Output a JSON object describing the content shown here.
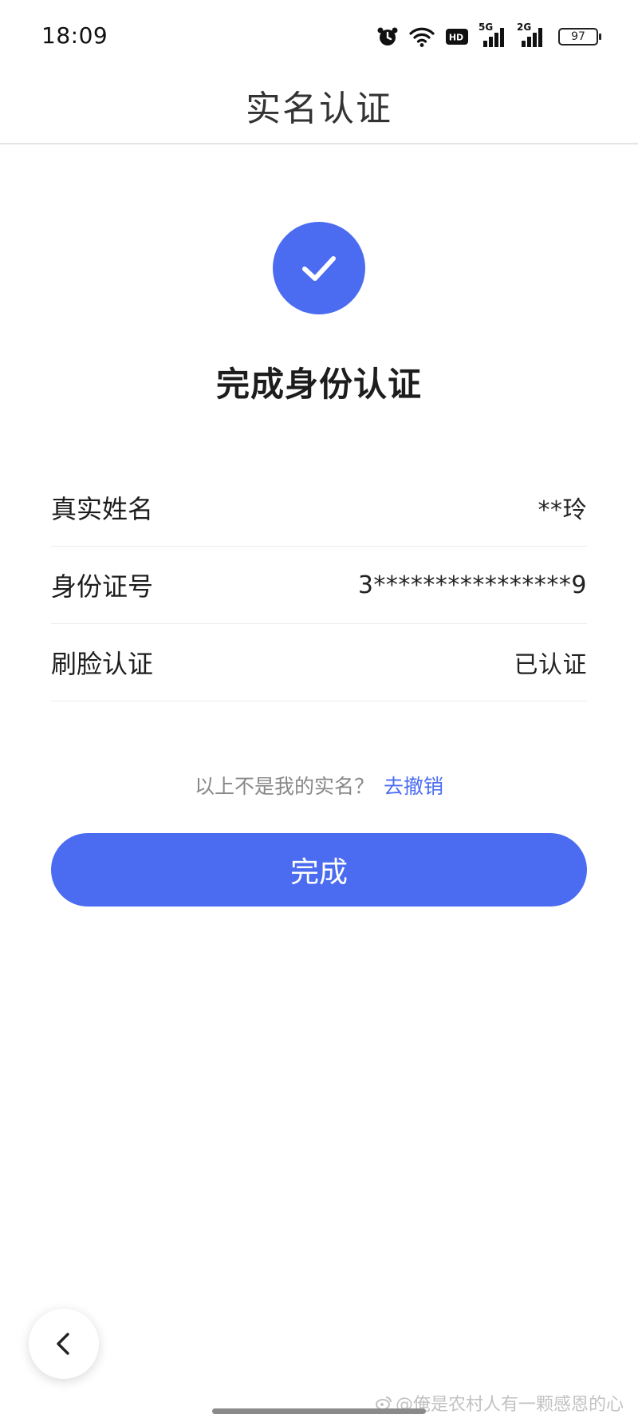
{
  "status_bar": {
    "time": "18:09",
    "hd_label": "HD",
    "net1_label": "5G",
    "net2_label": "2G",
    "battery": "97",
    "icons": [
      "alarm-icon",
      "wifi-icon",
      "hd-icon",
      "signal-5g-icon",
      "signal-2g-icon",
      "battery-icon"
    ]
  },
  "header": {
    "title": "实名认证"
  },
  "success": {
    "icon": "check-icon",
    "title": "完成身份认证"
  },
  "info": [
    {
      "label": "真实姓名",
      "value": "**玲"
    },
    {
      "label": "身份证号",
      "value": "3****************9"
    },
    {
      "label": "刷脸认证",
      "value": "已认证"
    }
  ],
  "revoke": {
    "question": "以上不是我的实名？",
    "link": "去撤销"
  },
  "done_button": {
    "label": "完成"
  },
  "back_button": {
    "icon": "chevron-left-icon"
  },
  "watermark": {
    "text": "@俺是农村人有一颗感恩的心"
  },
  "colors": {
    "accent": "#4b6cf0",
    "text": "#1d1d1d",
    "muted": "#888888",
    "divider": "#ececec"
  }
}
